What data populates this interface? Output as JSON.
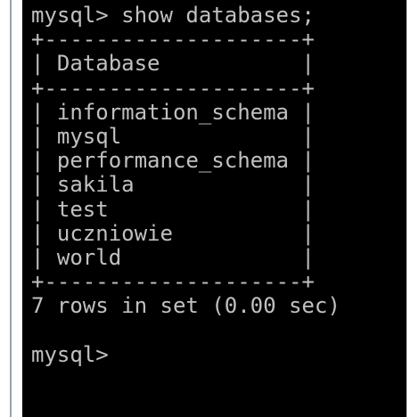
{
  "terminal": {
    "colors": {
      "background": "#000000",
      "text": "#c0c0c0",
      "frame": "#ffffff"
    },
    "lines": [
      "mysql> show databases;",
      "+--------------------+",
      "| Database           |",
      "+--------------------+",
      "| information_schema |",
      "| mysql              |",
      "| performance_schema |",
      "| sakila             |",
      "| test               |",
      "| uczniowie          |",
      "| world              |",
      "+--------------------+",
      "7 rows in set (0.00 sec)",
      "",
      "mysql>"
    ]
  }
}
